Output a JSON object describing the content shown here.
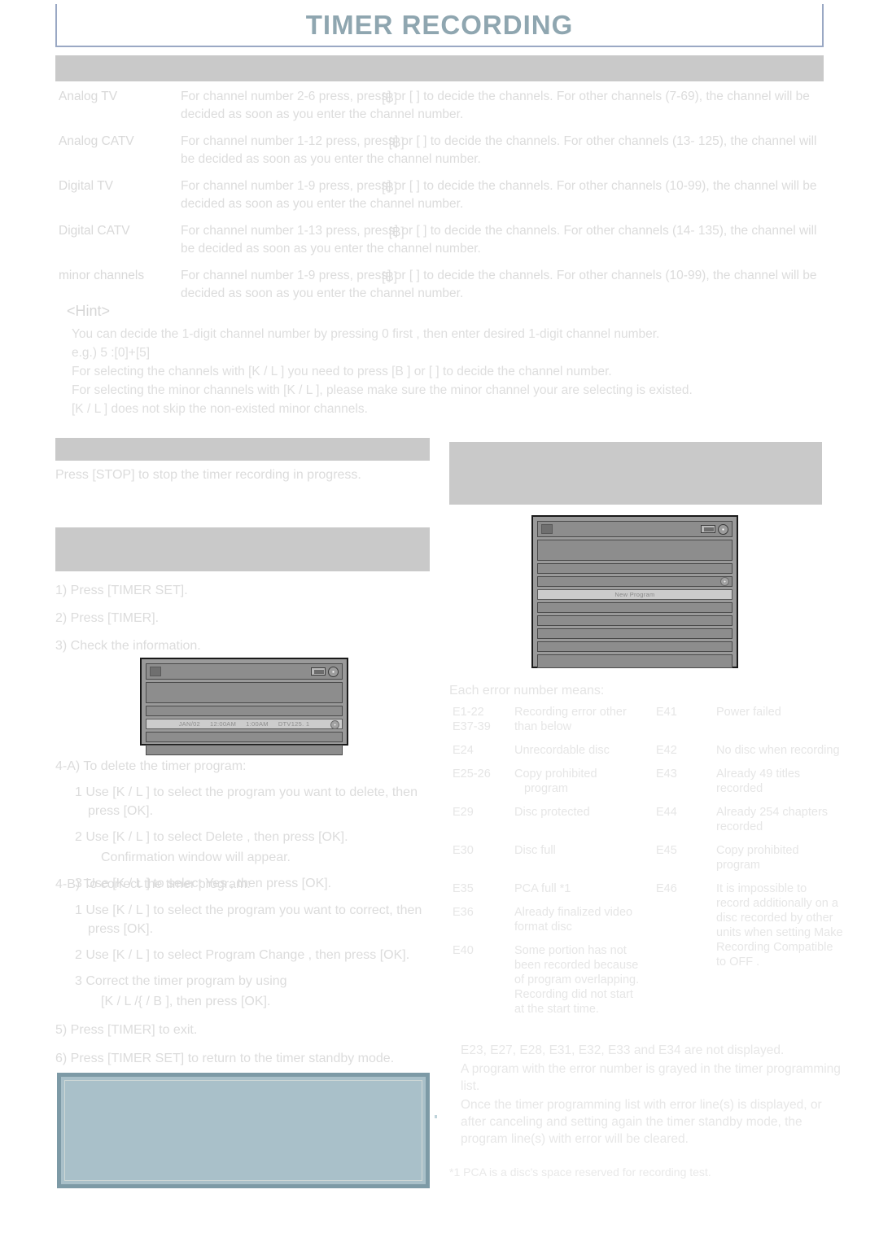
{
  "header": {
    "title": "TIMER RECORDING"
  },
  "section_bars": {
    "main": "",
    "stop": "",
    "right": "",
    "check": ""
  },
  "channel_table": {
    "rows": [
      {
        "label": "Analog TV",
        "line1_a": "For channel number 2-6 press, press",
        "key1": "[B]",
        "mid": "] or [",
        "key2": "  ]",
        "line1_b": "to decide the channels. For other channels (7-69),",
        "line2": "the channel will be decided as soon as you enter the channel number."
      },
      {
        "label": "Analog CATV",
        "line1_a": "For channel number 1-12 press, press",
        "key1": "[B]",
        "mid": "] or [",
        "key2": "  ]",
        "line1_b": "to decide the channels. For other channels (13-",
        "line2": "125), the channel will be decided as soon as you enter the channel number."
      },
      {
        "label": "Digital TV",
        "line1_a": "For channel number 1-9 press, press",
        "key1": "[B]",
        "mid": "] or [",
        "key2": "  ]",
        "line1_b": "to decide the channels. For other channels (10-99),",
        "line2": "the channel will be decided as soon as you enter the channel number."
      },
      {
        "label": "Digital CATV",
        "line1_a": "For channel number 1-13 press, press",
        "key1": "[B]",
        "mid": "] or [",
        "key2": "  ]",
        "line1_b": "to decide the channels. For other channels (14-",
        "line2": "135), the channel will be decided as soon as you enter the channel number."
      },
      {
        "label": "minor channels",
        "line1_a": "For channel number 1-9 press, press",
        "key1": "[B]",
        "mid": "] or [",
        "key2": "  ]",
        "line1_b": "to decide the channels. For other channels (10-99),",
        "line2": "the channel will be decided as soon as you enter the channel number."
      }
    ]
  },
  "hint": {
    "heading": "<Hint>",
    "line1": "You can decide the 1-digit channel number by pressing 0 first , then enter desired 1-digit channel number.",
    "line2": "e.g.)  5 :[0]+[5]",
    "line3": "For selecting the channels with [K / L ] you need to press [B ] or [   ] to decide the channel number.",
    "line4": "For selecting the minor channels with [K / L ], please make sure the minor channel your are selecting is existed.",
    "line5": "[K / L ] does not skip the non-existed minor channels."
  },
  "stop_section": {
    "text": "Press [STOP] to stop the timer recording in progress."
  },
  "steps": {
    "s1": "1) Press [TIMER SET].",
    "s2": "2) Press [TIMER].",
    "s3": "3) Check the information.",
    "s4a_head": "4-A) To delete the timer program:",
    "s4a_1": "1 Use [K / L ] to select the program you want to delete, then press [OK].",
    "s4a_2": "2 Use [K / L ] to select  Delete , then press [OK].",
    "s4a_2b": "Confirmation window will appear.",
    "s4a_3": "3 Use [K / L ] to select  Yes , then press [OK].",
    "s4b_head": "4-B) To correct the timer program:",
    "s4b_1": "1 Use [K / L ] to select the program you want to correct, then press [OK].",
    "s4b_2": "2 Use [K / L ] to select  Program Change , then press [OK].",
    "s4b_3": "3 Correct the timer program by using",
    "s4b_3b": "[K / L  /{    / B ], then press [OK].",
    "s5": "5) Press [TIMER] to exit.",
    "s6": "6) Press [TIMER SET] to return to the timer standby mode."
  },
  "screen_1": {
    "program_row": {
      "date": "JAN/02",
      "start": "12:00AM",
      "end": "1:00AM",
      "channel": "DTV125. 1"
    }
  },
  "screen_2": {
    "selected_row": "New Program"
  },
  "errors": {
    "heading": "Each error number means:",
    "rows": [
      {
        "code_l": "E1-22",
        "code_l2": "E37-39",
        "desc_l": "Recording error other",
        "desc_l2": "than below",
        "code_r": "E41",
        "desc_r": "Power failed"
      },
      {
        "code_l": "E24",
        "code_l2": "",
        "desc_l": "Unrecordable disc",
        "desc_l2": "",
        "code_r": "E42",
        "desc_r": "No disc when recording"
      },
      {
        "code_l": "E25-26",
        "code_l2": "",
        "desc_l": "Copy prohibited",
        "desc_l2": "program",
        "code_r": "E43",
        "desc_r": "Already 49 titles recorded"
      },
      {
        "code_l": "E29",
        "code_l2": "",
        "desc_l": "Disc protected",
        "desc_l2": "",
        "code_r": "E44",
        "desc_r": "Already 254 chapters recorded"
      },
      {
        "code_l": "E30",
        "code_l2": "",
        "desc_l": "Disc full",
        "desc_l2": "",
        "code_r": "E45",
        "desc_r": "Copy prohibited program"
      },
      {
        "code_l": "E35",
        "code_l2": "",
        "desc_l": "PCA full *1",
        "desc_l2": "",
        "code_r": "E46",
        "desc_r": "It is impossible to record additionally on a disc recorded by other units when setting  Make Recording Compatible  to  OFF ."
      },
      {
        "code_l": "E36",
        "code_l2": "",
        "desc_l": "Already finalized video format disc",
        "desc_l2": "",
        "code_r": "",
        "desc_r": ""
      },
      {
        "code_l": "E40",
        "code_l2": "",
        "desc_l": "Some portion has not been recorded because of program overlapping. Recording did not start at the start time.",
        "desc_l2": "",
        "code_r": "",
        "desc_r": ""
      }
    ]
  },
  "notes": {
    "n1": "E23, E27, E28, E31, E32, E33 and E34 are not displayed.",
    "n2": "A program with the error number is grayed in the timer programming list.",
    "n3": "Once the timer programming list with error line(s) is displayed, or after canceling and setting again the timer standby mode, the program line(s) with error will be cleared.",
    "footnote": "*1 PCA is a disc's space reserved for recording test."
  },
  "note_box": {
    "content": ""
  },
  "colors": {
    "title": "#8fa6b0",
    "title_border": "#9aa8c4",
    "gray_bar": "#c9c9c9",
    "note_box_fill": "#a9c0c9",
    "note_box_border": "#7d9aa6",
    "screen_bg": "#9a9a9a",
    "screen_row": "#8d8d8d",
    "screen_selected": "#cccccc"
  }
}
